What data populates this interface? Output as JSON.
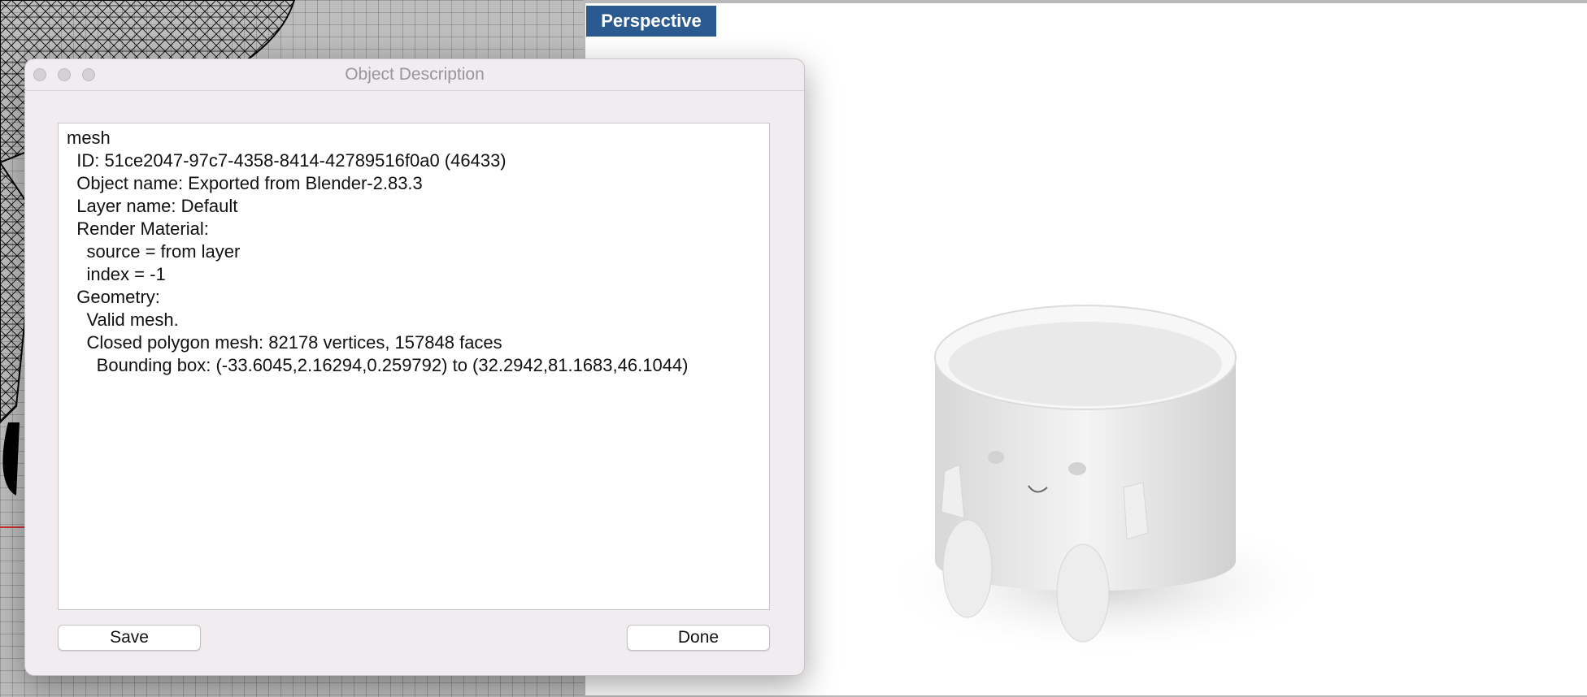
{
  "viewport": {
    "perspective_label": "Perspective"
  },
  "dialog": {
    "title": "Object Description",
    "lines": [
      "mesh",
      "",
      "  ID: 51ce2047-97c7-4358-8414-42789516f0a0 (46433)",
      "  Object name: Exported from Blender-2.83.3",
      "  Layer name: Default",
      "  Render Material:",
      "    source = from layer",
      "    index = -1",
      "",
      "  Geometry:",
      "    Valid mesh.",
      "    Closed polygon mesh: 82178 vertices, 157848 faces",
      "      Bounding box: (-33.6045,2.16294,0.259792) to (32.2942,81.1683,46.1044)"
    ],
    "save_label": "Save",
    "done_label": "Done"
  },
  "colors": {
    "perspective_tab": "#2b5a91",
    "dialog_bg": "#f1ecf0",
    "viewport_grid": "#bdbdbd"
  }
}
